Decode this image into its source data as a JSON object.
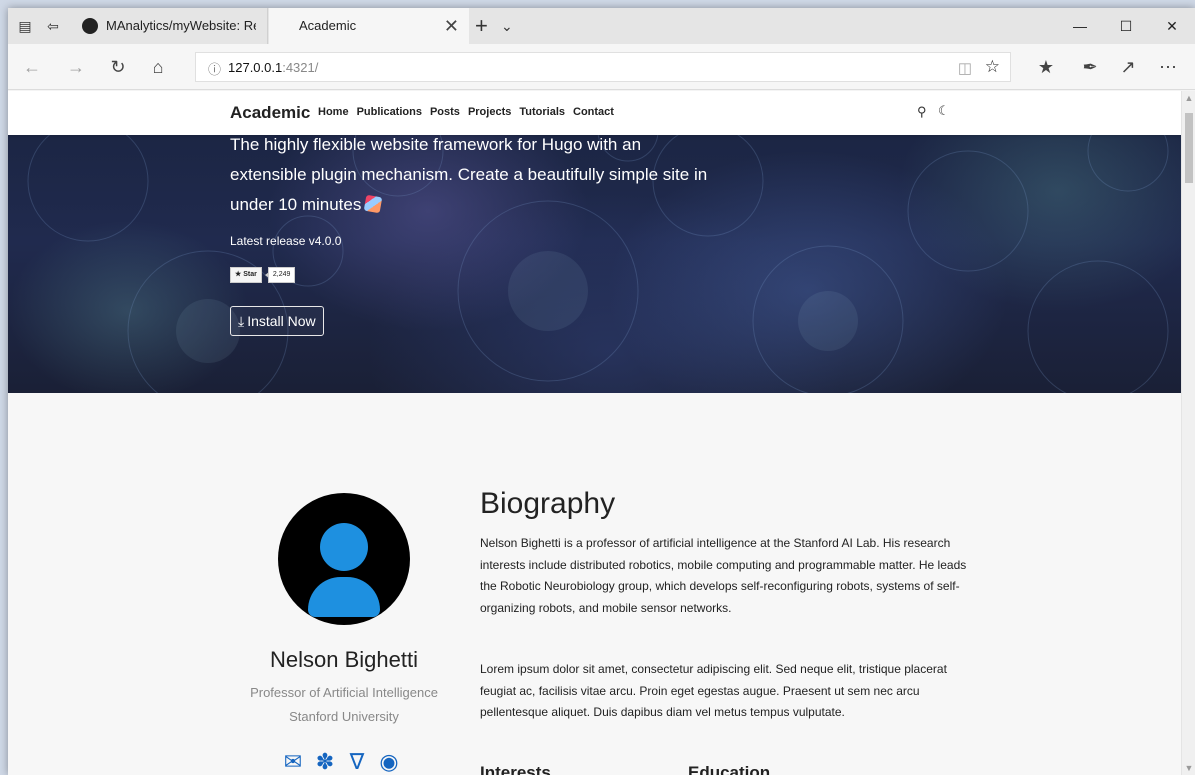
{
  "browser": {
    "tabs": [
      {
        "label": "MAnalytics/myWebsite: Rep"
      },
      {
        "label": "Academic"
      }
    ],
    "url_host": "127.0.0.1",
    "url_port": ":4321/"
  },
  "site": {
    "brand": "Academic",
    "menu": [
      "Home",
      "Publications",
      "Posts",
      "Projects",
      "Tutorials",
      "Contact"
    ]
  },
  "hero": {
    "lead_line1": "The highly flexible website framework for Hugo with an",
    "lead_line2": "extensible plugin mechanism. Create a beautifully simple site in",
    "lead_line3": "under 10 minutes",
    "release": "Latest release v4.0.0",
    "star_label": "Star",
    "star_count": "2,249",
    "install_label": "Install Now"
  },
  "profile": {
    "name": "Nelson Bighetti",
    "role": "Professor of Artificial Intelligence",
    "organization": "Stanford University"
  },
  "biography": {
    "title": "Biography",
    "p1": "Nelson Bighetti is a professor of artificial intelligence at the Stanford AI Lab. His research interests include distributed robotics, mobile computing and programmable matter. He leads the Robotic Neurobiology group, which develops self-reconfiguring robots, systems of self-organizing robots, and mobile sensor networks.",
    "p2": "Lorem ipsum dolor sit amet, consectetur adipiscing elit. Sed neque elit, tristique placerat feugiat ac, facilisis vitae arcu. Proin eget egestas augue. Praesent ut sem nec arcu pellentesque aliquet. Duis dapibus diam vel metus tempus vulputate.",
    "interests_heading": "Interests",
    "education_heading": "Education"
  },
  "colors": {
    "accent": "#1565c0",
    "avatar_fill": "#1e90e0"
  },
  "icons": [
    "window-icon",
    "tab-back-icon",
    "github-icon",
    "back-icon",
    "forward-icon",
    "refresh-icon",
    "home-icon",
    "info-icon",
    "reading-view-icon",
    "favorite-star-icon",
    "favorites-list-icon",
    "pen-icon",
    "share-icon",
    "more-icon",
    "search-icon",
    "moon-icon",
    "envelope-icon",
    "twitter-icon",
    "google-scholar-icon",
    "github-icon"
  ]
}
